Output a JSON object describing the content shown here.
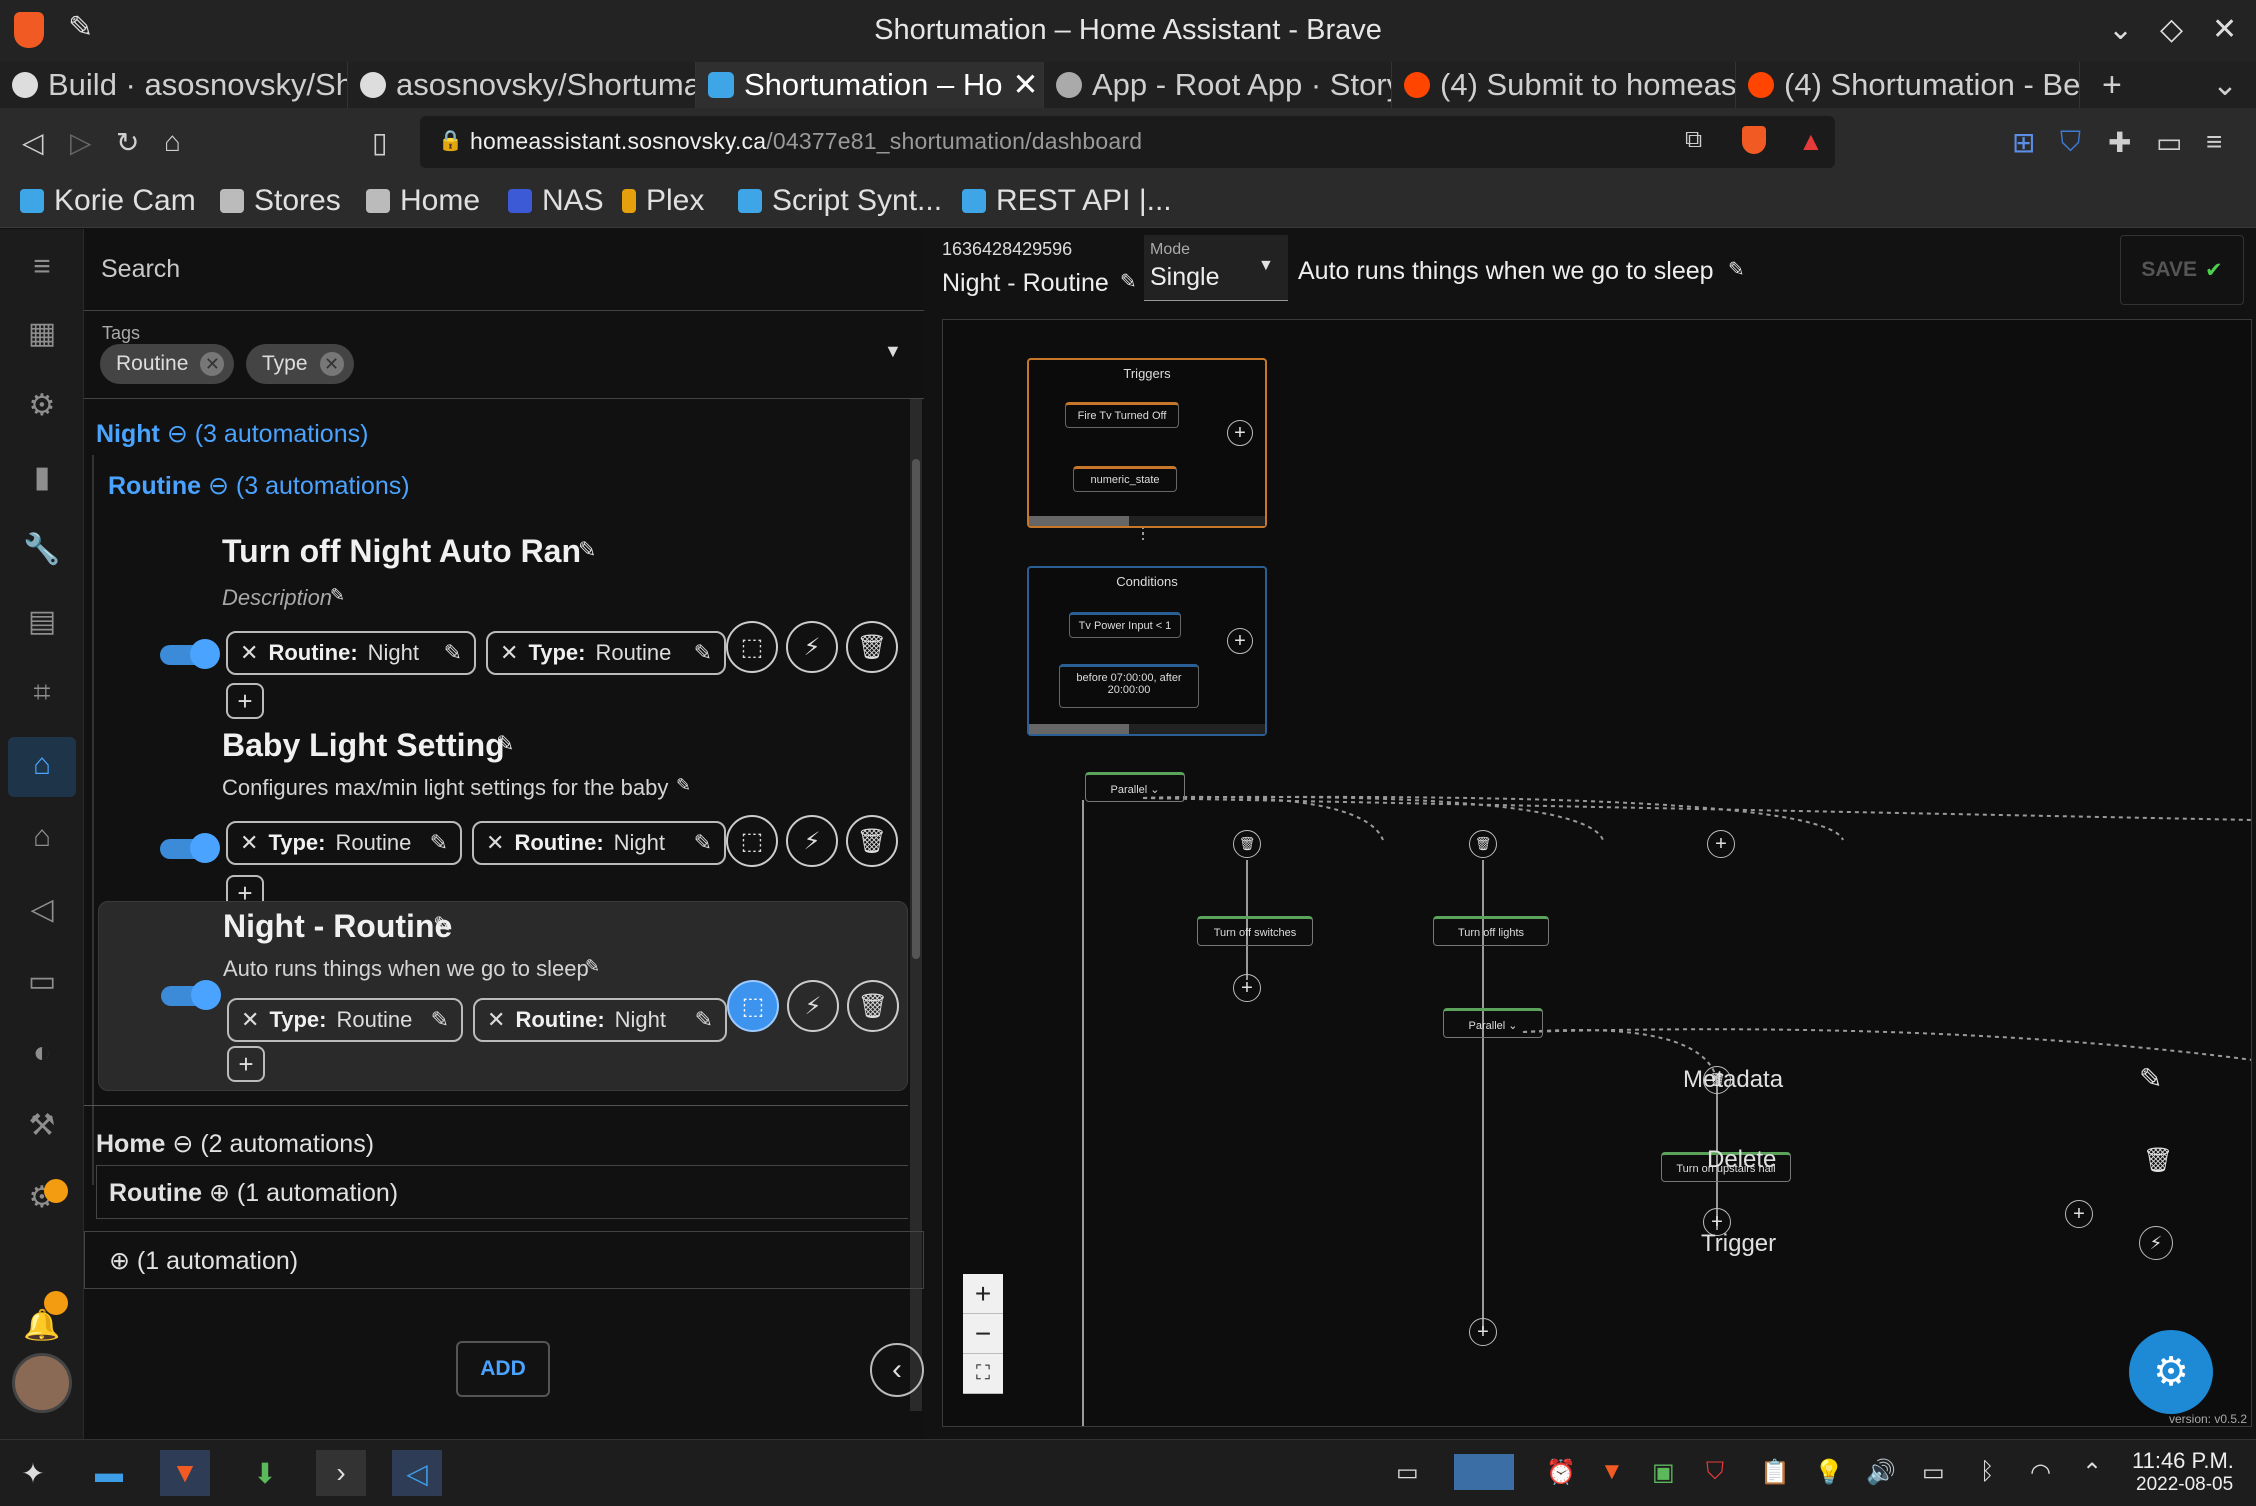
{
  "window": {
    "title": "Shortumation – Home Assistant - Brave"
  },
  "tabs": [
    {
      "label": "Build · asosnovsky/Sh",
      "icon": "github-icon"
    },
    {
      "label": "asosnovsky/Shortuma",
      "icon": "github-icon"
    },
    {
      "label": "Shortumation – Ho",
      "icon": "home-assistant-icon",
      "active": true
    },
    {
      "label": "App - Root App · Story",
      "icon": "storybook-icon"
    },
    {
      "label": "(4) Submit to homeas",
      "icon": "reddit-icon"
    },
    {
      "label": "(4) Shortumation - Be",
      "icon": "reddit-icon"
    }
  ],
  "address": {
    "domain": "homeassistant.sosnovsky.ca",
    "path": "/04377e81_shortumation/dashboard"
  },
  "bookmarks": [
    "Korie Cam",
    "Stores",
    "Home",
    "NAS",
    "Plex",
    "Script Synt...",
    "REST API |..."
  ],
  "search": {
    "placeholder": "Search"
  },
  "tags": {
    "label": "Tags",
    "chips": [
      "Routine",
      "Type"
    ]
  },
  "groups": {
    "night": {
      "name": "Night",
      "count": "(3 automations)"
    },
    "night_routine": {
      "name": "Routine",
      "count": "(3 automations)"
    },
    "home": {
      "name": "Home",
      "count": "(2 automations)"
    },
    "home_routine": {
      "name": "Routine",
      "count": "(1 automation)"
    },
    "other": {
      "count": "(1 automation)"
    }
  },
  "automations": [
    {
      "name": "Turn off Night Auto Ran",
      "description": "Description",
      "tags": [
        {
          "key": "Routine:",
          "value": "Night"
        },
        {
          "key": "Type:",
          "value": "Routine"
        }
      ]
    },
    {
      "name": "Baby Light Setting",
      "description": "Configures max/min light settings for the baby",
      "tags": [
        {
          "key": "Type:",
          "value": "Routine"
        },
        {
          "key": "Routine:",
          "value": "Night"
        }
      ]
    },
    {
      "name": "Night - Routine",
      "description": "Auto runs things when we go to sleep",
      "tags": [
        {
          "key": "Type:",
          "value": "Routine"
        },
        {
          "key": "Routine:",
          "value": "Night"
        }
      ]
    }
  ],
  "add_button": "ADD",
  "editor": {
    "id": "1636428429596",
    "name": "Night - Routine",
    "mode_label": "Mode",
    "mode_value": "Single",
    "description": "Auto runs things when we go to sleep",
    "save": "SAVE"
  },
  "flow": {
    "triggers_title": "Triggers",
    "triggers": [
      "Fire Tv Turned Off",
      "numeric_state"
    ],
    "conditions_title": "Conditions",
    "conditions": [
      "Tv Power Input < 1",
      "before 07:00:00, after 20:00:00"
    ],
    "parallel1": "Parallel",
    "actions": [
      "Turn off switches",
      "Turn off lights"
    ],
    "parallel2": "Parallel",
    "upstairs": "Turn on upstairs hall",
    "context_menu": [
      "Metadata",
      "Delete",
      "Trigger"
    ],
    "version": "version: v0.5.2"
  },
  "taskbar": {
    "time": "11:46 P.M.",
    "date": "2022-08-05"
  },
  "colors": {
    "accent": "#4aa3ff",
    "trigger_border": "#c7772a",
    "condition_border": "#2a5f95",
    "gear": "#1e8ad6"
  }
}
